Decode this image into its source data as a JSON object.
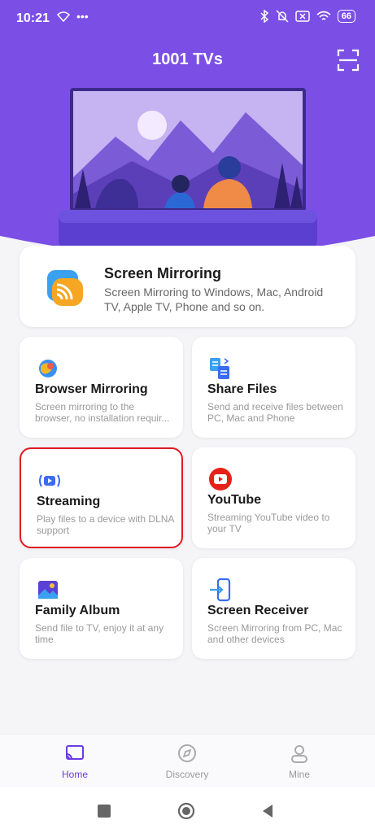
{
  "status": {
    "time": "10:21",
    "battery": "66"
  },
  "header": {
    "title": "1001 TVs"
  },
  "mirror_card": {
    "title": "Screen Mirroring",
    "desc": "Screen Mirroring to Windows, Mac, Android TV, Apple TV, Phone and so on."
  },
  "tiles": [
    {
      "title": "Browser Mirroring",
      "desc": "Screen mirroring to the browser, no installation requir..."
    },
    {
      "title": "Share Files",
      "desc": "Send and receive files between PC, Mac and Phone"
    },
    {
      "title": "Streaming",
      "desc": "Play files to a device with DLNA support"
    },
    {
      "title": "YouTube",
      "desc": "Streaming YouTube video to your TV"
    },
    {
      "title": "Family Album",
      "desc": "Send file to TV, enjoy it at any time"
    },
    {
      "title": "Screen Receiver",
      "desc": "Screen Mirroring from PC, Mac and other devices"
    }
  ],
  "nav": {
    "home": "Home",
    "discovery": "Discovery",
    "mine": "Mine"
  },
  "colors": {
    "primary": "#7b4fe6",
    "selected_border": "#e01b24",
    "youtube": "#e62117"
  }
}
